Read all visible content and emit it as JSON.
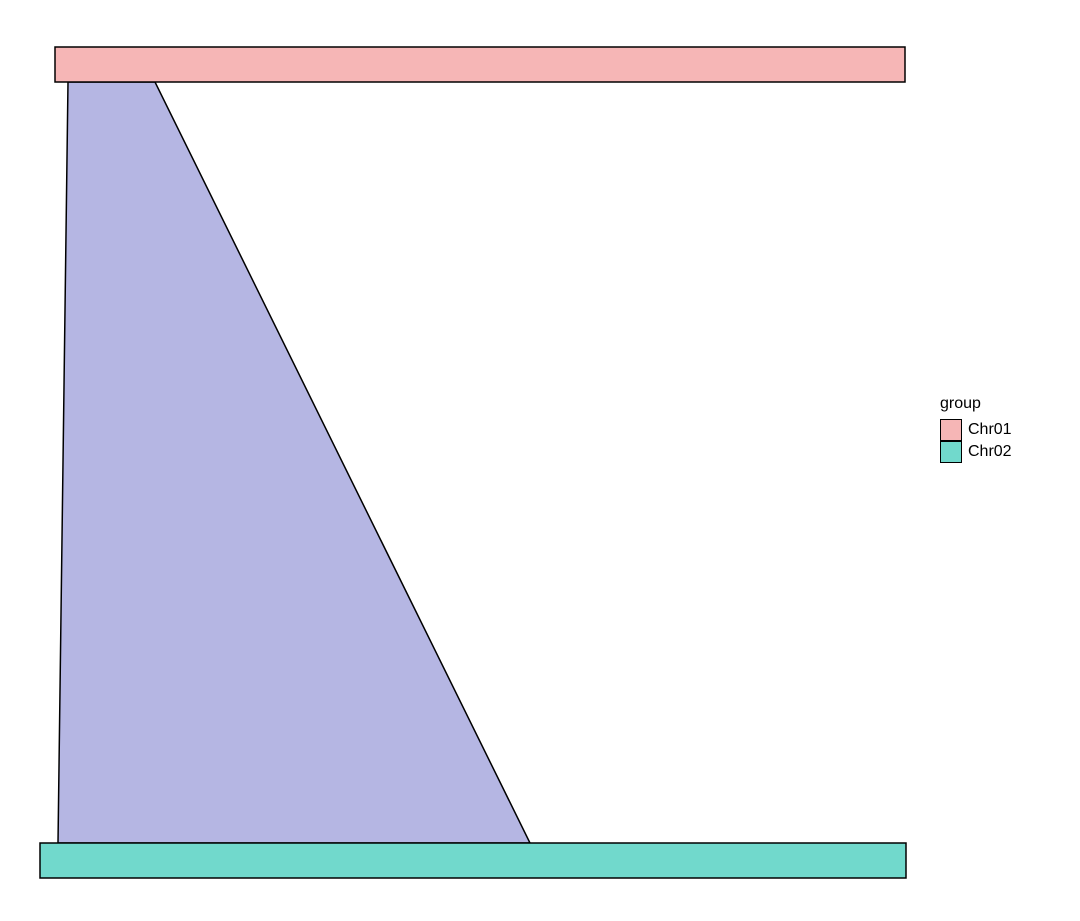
{
  "legend": {
    "title": "group",
    "items": [
      {
        "label": "Chr01",
        "color": "#f6b6b6"
      },
      {
        "label": "Chr02",
        "color": "#71d9cc"
      }
    ]
  },
  "colors": {
    "ribbon": "#b5b6e3",
    "stroke": "#000000"
  },
  "chart_data": {
    "type": "synteny",
    "description": "Two horizontal chromosome bars (Chr01 top, Chr02 bottom) connected by one filled ribbon representing a mapped segment between them.",
    "x_range": [
      0,
      100
    ],
    "bars": [
      {
        "name": "Chr01",
        "y": "top",
        "x0": 2,
        "x1": 100,
        "color": "#f6b6b6"
      },
      {
        "name": "Chr02",
        "y": "bottom",
        "x0": 0,
        "x1": 100,
        "color": "#71d9cc"
      }
    ],
    "ribbons": [
      {
        "top_x0": 3,
        "top_x1": 13,
        "bot_x0": 2,
        "bot_x1": 57,
        "color": "#b5b6e3"
      }
    ]
  }
}
